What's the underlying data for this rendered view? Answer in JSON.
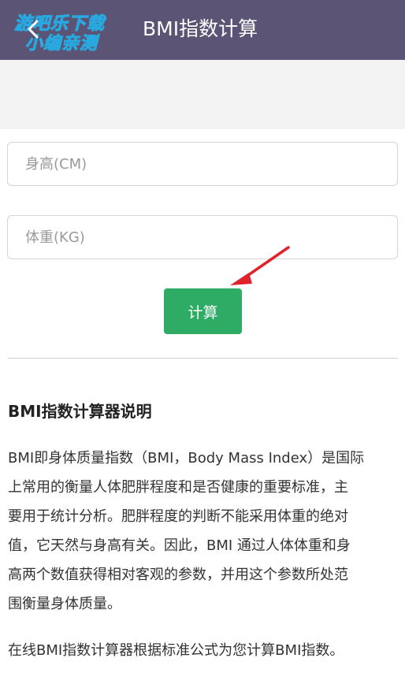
{
  "header": {
    "title": "BMI指数计算",
    "watermark_line1": "游吧乐下载",
    "watermark_line2": "小编亲测",
    "back_icon": "chevron-left-icon"
  },
  "form": {
    "height_placeholder": "身高(CM)",
    "weight_placeholder": "体重(KG)",
    "calculate_label": "计算"
  },
  "annotation": {
    "arrow_color": "#e0232b"
  },
  "colors": {
    "header_bg": "#5b5475",
    "button_bg": "#2eab64"
  },
  "description": {
    "title": "BMI指数计算器说明",
    "paragraph1_lines": [
      "BMI即身体质量指数（BMI，Body Mass Index）是国际",
      "上常用的衡量人体肥胖程度和是否健康的重要标准，主",
      "要用于统计分析。肥胖程度的判断不能采用体重的绝对",
      "值，它天然与身高有关。因此，BMI 通过人体体重和身",
      "高两个数值获得相对客观的参数，并用这个参数所处范",
      "围衡量身体质量。"
    ],
    "paragraph2": "在线BMI指数计算器根据标准公式为您计算BMI指数。"
  }
}
